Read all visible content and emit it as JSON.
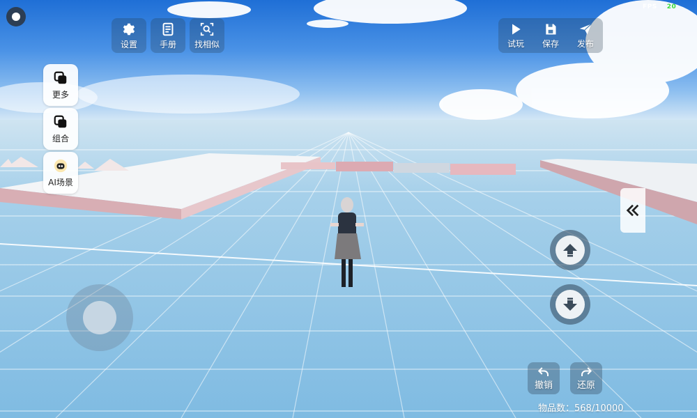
{
  "hud": {
    "fps_label": "FPS",
    "fps_value": "20",
    "top_left": [
      {
        "label": "设置",
        "icon": "gear-icon"
      },
      {
        "label": "手册",
        "icon": "manual-icon"
      },
      {
        "label": "找相似",
        "icon": "find-similar-icon"
      }
    ],
    "top_right": [
      {
        "label": "试玩",
        "icon": "play-icon"
      },
      {
        "label": "保存",
        "icon": "save-icon"
      },
      {
        "label": "发布",
        "icon": "publish-icon"
      }
    ],
    "side": [
      {
        "label": "更多",
        "icon": "layers-icon"
      },
      {
        "label": "组合",
        "icon": "group-icon"
      },
      {
        "label": "AI场景",
        "icon": "ai-robot-icon"
      }
    ],
    "undo_label": "撤销",
    "redo_label": "还原",
    "item_count": "物品数：568/10000"
  },
  "colors": {
    "hud_panel": "#283c50",
    "fps_value": "#3ddc3d",
    "grid_line": "#ffffff",
    "platform_pink": "#e8c4c8"
  }
}
